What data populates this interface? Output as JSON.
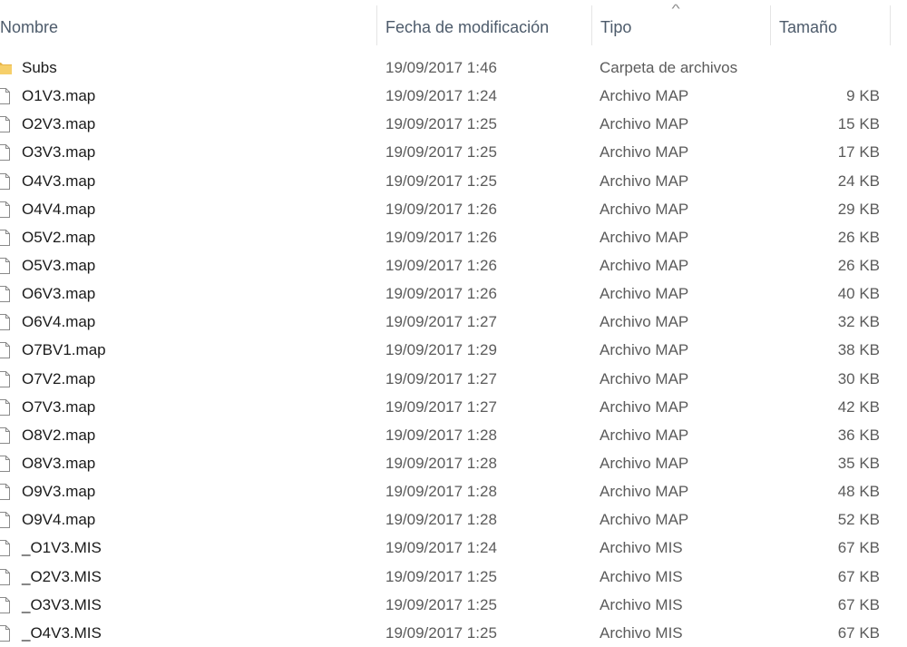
{
  "columns": {
    "name": "Nombre",
    "date": "Fecha de modificación",
    "type": "Tipo",
    "size": "Tamaño",
    "sorted_column": "type",
    "sort_direction": "ascending"
  },
  "colors": {
    "header_text": "#4d5b6b",
    "row_text": "#1a1a1a",
    "detail_text": "#5b5b5b",
    "folder": "#e8b54a"
  },
  "rows": [
    {
      "name": "Subs",
      "date": "19/09/2017 1:46",
      "type": "Carpeta de archivos",
      "size": "",
      "icon": "folder-icon"
    },
    {
      "name": "O1V3.map",
      "date": "19/09/2017 1:24",
      "type": "Archivo MAP",
      "size": "9 KB",
      "icon": "file-icon"
    },
    {
      "name": "O2V3.map",
      "date": "19/09/2017 1:25",
      "type": "Archivo MAP",
      "size": "15 KB",
      "icon": "file-icon"
    },
    {
      "name": "O3V3.map",
      "date": "19/09/2017 1:25",
      "type": "Archivo MAP",
      "size": "17 KB",
      "icon": "file-icon"
    },
    {
      "name": "O4V3.map",
      "date": "19/09/2017 1:25",
      "type": "Archivo MAP",
      "size": "24 KB",
      "icon": "file-icon"
    },
    {
      "name": "O4V4.map",
      "date": "19/09/2017 1:26",
      "type": "Archivo MAP",
      "size": "29 KB",
      "icon": "file-icon"
    },
    {
      "name": "O5V2.map",
      "date": "19/09/2017 1:26",
      "type": "Archivo MAP",
      "size": "26 KB",
      "icon": "file-icon"
    },
    {
      "name": "O5V3.map",
      "date": "19/09/2017 1:26",
      "type": "Archivo MAP",
      "size": "26 KB",
      "icon": "file-icon"
    },
    {
      "name": "O6V3.map",
      "date": "19/09/2017 1:26",
      "type": "Archivo MAP",
      "size": "40 KB",
      "icon": "file-icon"
    },
    {
      "name": "O6V4.map",
      "date": "19/09/2017 1:27",
      "type": "Archivo MAP",
      "size": "32 KB",
      "icon": "file-icon"
    },
    {
      "name": "O7BV1.map",
      "date": "19/09/2017 1:29",
      "type": "Archivo MAP",
      "size": "38 KB",
      "icon": "file-icon"
    },
    {
      "name": "O7V2.map",
      "date": "19/09/2017 1:27",
      "type": "Archivo MAP",
      "size": "30 KB",
      "icon": "file-icon"
    },
    {
      "name": "O7V3.map",
      "date": "19/09/2017 1:27",
      "type": "Archivo MAP",
      "size": "42 KB",
      "icon": "file-icon"
    },
    {
      "name": "O8V2.map",
      "date": "19/09/2017 1:28",
      "type": "Archivo MAP",
      "size": "36 KB",
      "icon": "file-icon"
    },
    {
      "name": "O8V3.map",
      "date": "19/09/2017 1:28",
      "type": "Archivo MAP",
      "size": "35 KB",
      "icon": "file-icon"
    },
    {
      "name": "O9V3.map",
      "date": "19/09/2017 1:28",
      "type": "Archivo MAP",
      "size": "48 KB",
      "icon": "file-icon"
    },
    {
      "name": "O9V4.map",
      "date": "19/09/2017 1:28",
      "type": "Archivo MAP",
      "size": "52 KB",
      "icon": "file-icon"
    },
    {
      "name": "_O1V3.MIS",
      "date": "19/09/2017 1:24",
      "type": "Archivo MIS",
      "size": "67 KB",
      "icon": "file-icon"
    },
    {
      "name": "_O2V3.MIS",
      "date": "19/09/2017 1:25",
      "type": "Archivo MIS",
      "size": "67 KB",
      "icon": "file-icon"
    },
    {
      "name": "_O3V3.MIS",
      "date": "19/09/2017 1:25",
      "type": "Archivo MIS",
      "size": "67 KB",
      "icon": "file-icon"
    },
    {
      "name": "_O4V3.MIS",
      "date": "19/09/2017 1:25",
      "type": "Archivo MIS",
      "size": "67 KB",
      "icon": "file-icon"
    }
  ]
}
